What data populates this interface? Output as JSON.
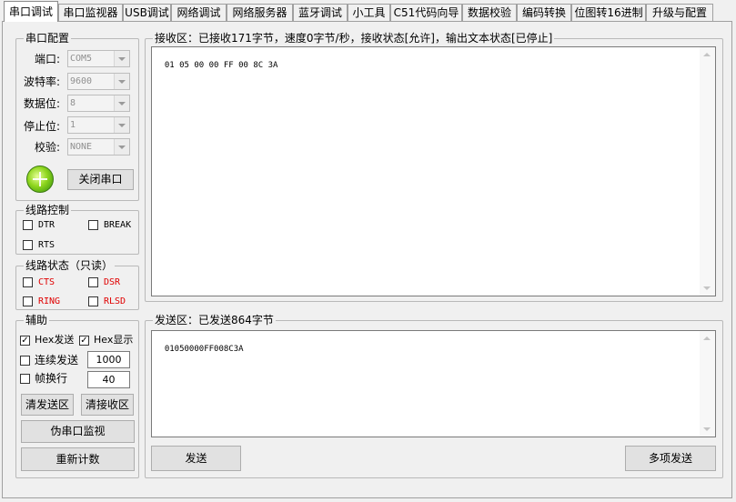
{
  "tabs": [
    {
      "label": "串口调试",
      "active": true
    },
    {
      "label": "串口监视器"
    },
    {
      "label": "USB调试"
    },
    {
      "label": "网络调试"
    },
    {
      "label": "网络服务器"
    },
    {
      "label": "蓝牙调试"
    },
    {
      "label": "小工具"
    },
    {
      "label": "C51代码向导"
    },
    {
      "label": "数据校验"
    },
    {
      "label": "编码转换"
    },
    {
      "label": "位图转16进制"
    },
    {
      "label": "升级与配置"
    }
  ],
  "serial_config": {
    "title": "串口配置",
    "port_label": "端口:",
    "port_value": "COM5",
    "baud_label": "波特率:",
    "baud_value": "9600",
    "databits_label": "数据位:",
    "databits_value": "8",
    "stopbits_label": "停止位:",
    "stopbits_value": "1",
    "parity_label": "校验:",
    "parity_value": "NONE",
    "close_button": "关闭串口"
  },
  "line_control": {
    "title": "线路控制",
    "dtr": "DTR",
    "break": "BREAK",
    "rts": "RTS"
  },
  "line_status": {
    "title": "线路状态（只读）",
    "cts": "CTS",
    "dsr": "DSR",
    "ring": "RING",
    "rlsd": "RLSD",
    "status_color": "#e00000"
  },
  "aux": {
    "title": "辅助",
    "hex_send": "Hex发送",
    "hex_send_checked": true,
    "hex_display": "Hex显示",
    "hex_display_checked": true,
    "continuous_send": "连续发送",
    "continuous_value": "1000",
    "frame_break": "帧换行",
    "frame_value": "40",
    "clear_send": "清发送区",
    "clear_recv": "清接收区",
    "pseudo_monitor": "伪串口监视",
    "recount": "重新计数"
  },
  "receive": {
    "title": "接收区：已接收171字节，速度0字节/秒，接收状态[允许]，输出文本状态[已停止]",
    "content": "01 05 00 00 FF 00 8C 3A"
  },
  "send": {
    "title": "发送区：已发送864字节",
    "content": "01050000FF008C3A",
    "send_button": "发送",
    "multi_send_button": "多项发送"
  }
}
